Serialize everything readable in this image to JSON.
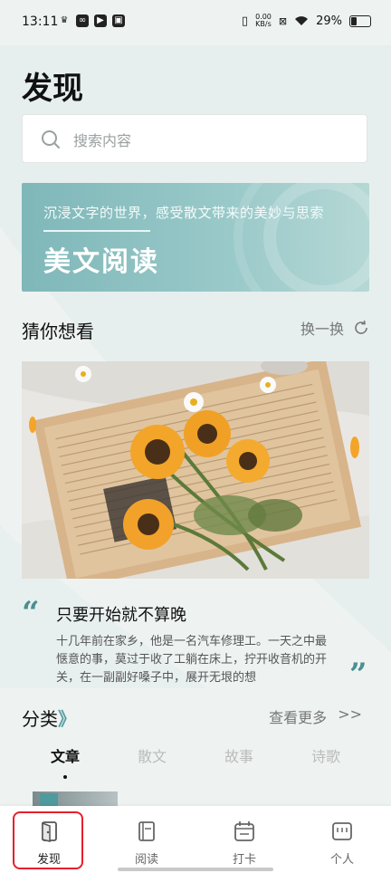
{
  "status": {
    "time": "13:11",
    "net_speed": "0.00\nKB/s",
    "battery": "29%"
  },
  "page": {
    "title": "发现"
  },
  "search": {
    "placeholder": "搜索内容"
  },
  "banner": {
    "subtitle": "沉浸文字的世界，感受散文带来的美妙与思索",
    "title": "美文阅读"
  },
  "recommend": {
    "heading": "猜你想看",
    "refresh_label": "换一换"
  },
  "quote": {
    "title": "只要开始就不算晚",
    "excerpt": "十几年前在家乡，他是一名汽车修理工。一天之中最惬意的事，莫过于收了工躺在床上，拧开收音机的开关，在一副副好嗓子中，展开无垠的想"
  },
  "category": {
    "heading": "分类",
    "more_label": "查看更多",
    "more_arrow": ">>",
    "tabs": [
      "文章",
      "散文",
      "故事",
      "诗歌"
    ]
  },
  "nav": {
    "items": [
      {
        "label": "发现",
        "icon": "discover-door-icon"
      },
      {
        "label": "阅读",
        "icon": "book-icon"
      },
      {
        "label": "打卡",
        "icon": "calendar-icon"
      },
      {
        "label": "个人",
        "icon": "profile-icon"
      }
    ]
  },
  "colors": {
    "accent": "#4a8f92",
    "highlight": "#e5202a"
  }
}
